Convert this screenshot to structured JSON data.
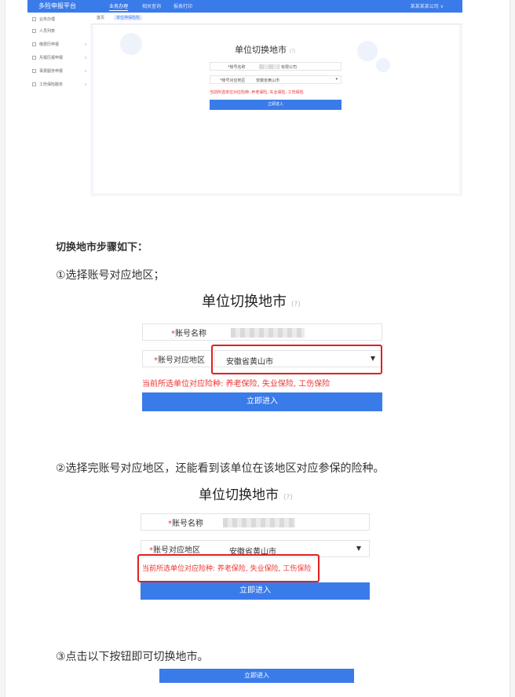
{
  "app": {
    "brand": "多险申报平台",
    "nav": [
      "业务办理",
      "相关查询",
      "报表打印"
    ],
    "user": "某某某某公司 ∨",
    "sidebar": [
      "业务办理",
      "人员列表",
      "缴费历申报",
      "月报历报申报",
      "事费服务申报",
      "工伤保险服务"
    ],
    "tabs": [
      "首页",
      "单位停保险险"
    ],
    "title": "单位切换地市",
    "title_hint": "(?)",
    "account_label": "*账号名称",
    "account_value": "有限公司",
    "region_label": "*账号对应地区",
    "region_value": "安徽省黄山市",
    "warning": "当前所选单位对应险种: 养老保险, 失业保险, 工伤保险",
    "button": "立即进入"
  },
  "article": {
    "heading": "切换地市步骤如下：",
    "step1": "①选择账号对应地区；",
    "step2": "②选择完账号对应地区，还能看到该单位在该地区对应参保的险种。",
    "step3": "③点击以下按钮即可切换地市。"
  },
  "figure1": {
    "title": "单位切换地市",
    "title_hint": "(?)",
    "account_label": "账号名称",
    "region_label": "账号对应地区",
    "region_value": "安徽省黄山市",
    "warning": "当前所选单位对应险种: 养老保险, 失业保险, 工伤保险",
    "button": "立即进入"
  },
  "figure2": {
    "title": "单位切换地市",
    "title_hint": "(?)",
    "account_label": "账号名称",
    "region_label": "账号对应地区",
    "region_value": "安徽省黄山市",
    "warning": "当前所选单位对应险种: 养老保险, 失业保险, 工伤保险",
    "button": "立即进入"
  },
  "figure3": {
    "button": "立即进入"
  },
  "colors": {
    "accent": "#3a7bea",
    "warning": "#e33333",
    "highlight": "#e02020"
  }
}
